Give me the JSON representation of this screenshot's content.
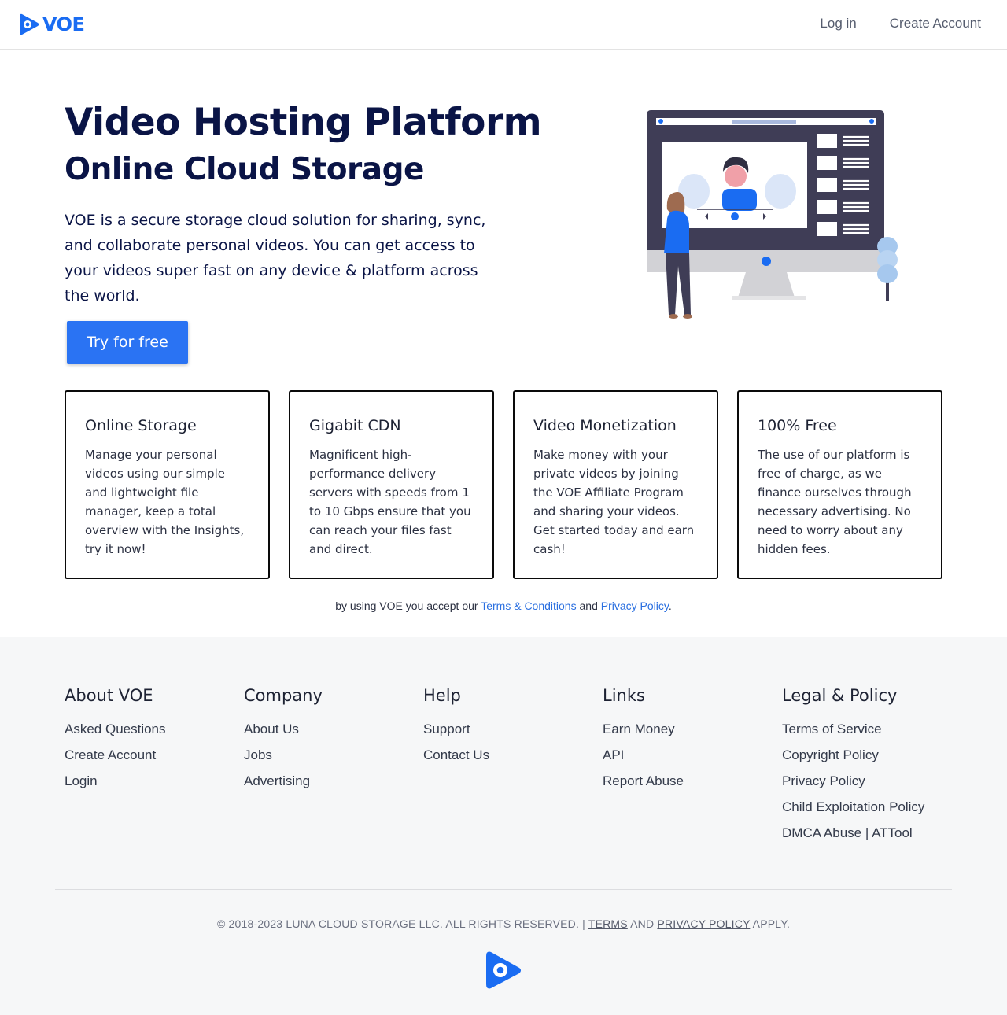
{
  "brand": {
    "name": "VOE",
    "color": "#1a6cf2"
  },
  "header": {
    "login": "Log in",
    "create_account": "Create Account"
  },
  "hero": {
    "title": "Video Hosting Platform",
    "subtitle": "Online Cloud Storage",
    "description": "VOE is a secure storage cloud solution for sharing, sync, and collaborate personal videos. You can get access to your videos super fast on any device & platform across the world.",
    "cta": "Try for free"
  },
  "features": [
    {
      "title": "Online Storage",
      "text": "Manage your personal videos using our simple and lightweight file manager, keep a total overview with the Insights, try it now!"
    },
    {
      "title": "Gigabit CDN",
      "text": "Magnificent high-performance delivery servers with speeds from 1 to 10 Gbps ensure that you can reach your files fast and direct."
    },
    {
      "title": "Video Monetization",
      "text": "Make money with your private videos by joining the VOE Affiliate Program and sharing your videos. Get started today and earn cash!"
    },
    {
      "title": "100% Free",
      "text": "The use of our platform is free of charge, as we finance ourselves through necessary advertising. No need to worry about any hidden fees."
    }
  ],
  "acceptance": {
    "prefix": "by using VOE you accept our ",
    "terms": "Terms & Conditions",
    "middle": " and ",
    "privacy": "Privacy Policy",
    "suffix": "."
  },
  "footer": {
    "columns": [
      {
        "title": "About VOE",
        "links": [
          "Asked Questions",
          "Create Account",
          "Login"
        ]
      },
      {
        "title": "Company",
        "links": [
          "About Us",
          "Jobs",
          "Advertising"
        ]
      },
      {
        "title": "Help",
        "links": [
          "Support",
          "Contact Us"
        ]
      },
      {
        "title": "Links",
        "links": [
          "Earn Money",
          "API",
          "Report Abuse"
        ]
      },
      {
        "title": "Legal & Policy",
        "links": [
          "Terms of Service",
          "Copyright Policy",
          "Privacy Policy",
          "Child Exploitation Policy"
        ],
        "dmca": "DMCA Abuse",
        "separator": "|",
        "attool": "ATTool"
      }
    ],
    "copyright": {
      "text": "© 2018-2023 LUNA CLOUD STORAGE LLC. ALL RIGHTS RESERVED. | ",
      "terms": "TERMS",
      "and": " AND ",
      "privacy": "PRIVACY POLICY",
      "apply": " APPLY."
    }
  }
}
